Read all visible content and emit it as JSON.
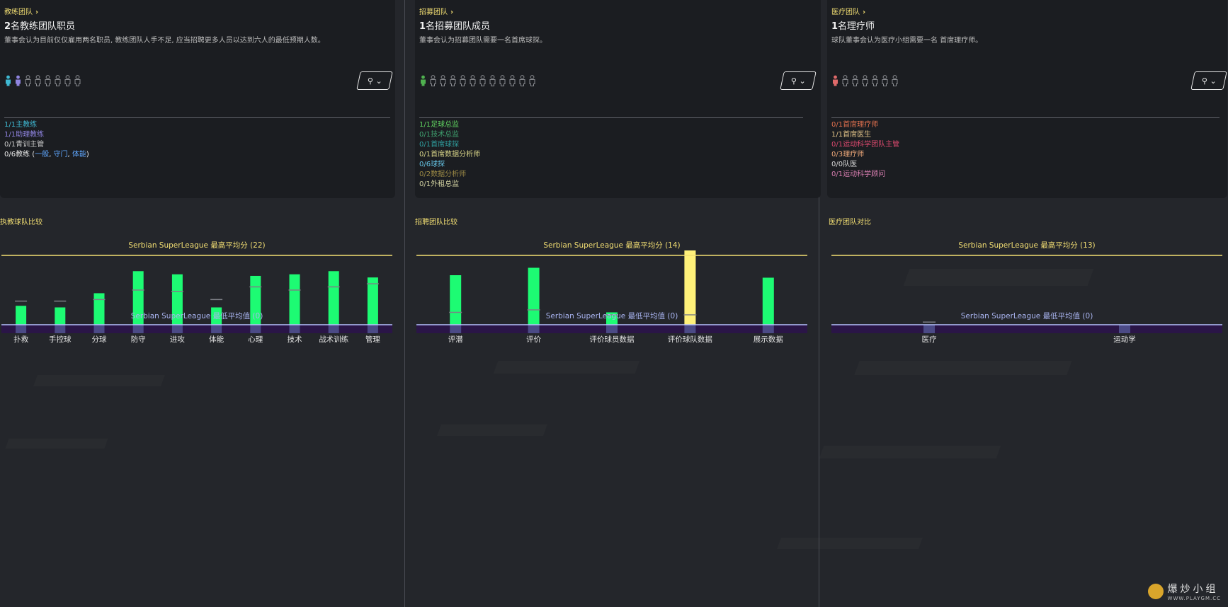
{
  "watermark": {
    "text": "爆炒小组",
    "url": "WWW.PLAYGM.CC"
  },
  "panels": [
    {
      "id": "coaching",
      "header": "教练团队",
      "title_num": "2",
      "title_rest": "名教练团队职员",
      "desc": "董事会认为目前仅仅雇用两名职员, 教练团队人手不足, 应当招聘更多人员以达到六人的最低预期人数。",
      "filled": [
        "#3fb9d3",
        "#8f84e0"
      ],
      "empty_count": 6,
      "roles": [
        {
          "text": "1/1主教练",
          "color": "#3fb9d3"
        },
        {
          "text": "1/1助理教练",
          "color": "#8f84e0"
        },
        {
          "text": "0/1青训主管",
          "color": "#c9c9c9"
        },
        {
          "pre": "0/6教练 (",
          "l1": "一般",
          "s1": ", ",
          "l2": "守门",
          "s2": ", ",
          "l3": "体能",
          "post": ")",
          "color": "#e8e8e8",
          "link": "#5fa7ff"
        }
      ],
      "comparison_title": "执教球队比较",
      "chart_data": {
        "type": "bar",
        "categories": [
          "扑救",
          "手控球",
          "分球",
          "防守",
          "进攻",
          "体能",
          "心理",
          "技术",
          "战术训练",
          "管理"
        ],
        "values": [
          6,
          5.5,
          10,
          17,
          16,
          5.5,
          15.5,
          16,
          17,
          15
        ],
        "marker": [
          7.5,
          7.5,
          8,
          11,
          10.5,
          8,
          12,
          11,
          12,
          13
        ],
        "max_label": "Serbian SuperLeague 最高平均分 (22)",
        "min_label": "Serbian SuperLeague 最低平均值 (0)",
        "ymax": 22,
        "bar_color": "#1dfb73"
      }
    },
    {
      "id": "recruitment",
      "header": "招募团队",
      "title_num": "1",
      "title_rest": "名招募团队成员",
      "desc": "董事会认为招募团队需要一名首席球探。",
      "filled": [
        "#4fb14f"
      ],
      "empty_count": 11,
      "roles": [
        {
          "text": "1/1足球总监",
          "color": "#5fd05f"
        },
        {
          "text": "0/1技术总监",
          "color": "#3fa26f"
        },
        {
          "text": "0/1首席球探",
          "color": "#2f9f9f"
        },
        {
          "text": "0/1首席数据分析师",
          "color": "#d8d488"
        },
        {
          "text": "0/6球探",
          "color": "#64c2e2"
        },
        {
          "text": "0/2数据分析师",
          "color": "#9c8a45"
        },
        {
          "text": "0/1外租总监",
          "color": "#d0d0a0"
        }
      ],
      "comparison_title": "招聘团队比较",
      "chart_data": {
        "type": "bar",
        "categories": [
          "评潜",
          "评价",
          "评价球员数据",
          "评价球队数据",
          "展示数据"
        ],
        "values": [
          10,
          11.5,
          2.5,
          15,
          9.5
        ],
        "marker": [
          2.5,
          3,
          2,
          2,
          0
        ],
        "highlight": [
          false,
          false,
          false,
          true,
          false
        ],
        "max_label": "Serbian SuperLeague 最高平均分 (14)",
        "min_label": "Serbian SuperLeague 最低平均值 (0)",
        "ymax": 14,
        "bar_color": "#1dfb73",
        "highlight_color": "#fff17a"
      }
    },
    {
      "id": "medical",
      "header": "医疗团队",
      "title_num": "1",
      "title_rest": "名理疗师",
      "desc": "球队董事会认为医疗小组需要一名 首席理疗师。",
      "filled": [
        "#e06a6a"
      ],
      "empty_count": 6,
      "roles": [
        {
          "text": "0/1首席理疗师",
          "color": "#e0704e"
        },
        {
          "text": "1/1首席医生",
          "color": "#e6c68a"
        },
        {
          "text": "0/1运动科学团队主管",
          "color": "#d9496d"
        },
        {
          "text": "0/3理疗师",
          "color": "#f0aa7a"
        },
        {
          "text": "0/0队医",
          "color": "#d8d8d8"
        },
        {
          "text": "0/1运动科学顾问",
          "color": "#d87eb0"
        }
      ],
      "comparison_title": "医疗团队对比",
      "chart_data": {
        "type": "bar",
        "categories": [
          "医疗",
          "运动学"
        ],
        "values": [
          0,
          0
        ],
        "marker": [
          0.5,
          0
        ],
        "max_label": "Serbian SuperLeague 最高平均分 (13)",
        "min_label": "Serbian SuperLeague 最低平均值 (0)",
        "ymax": 13,
        "bar_color": "#1dfb73"
      }
    }
  ]
}
